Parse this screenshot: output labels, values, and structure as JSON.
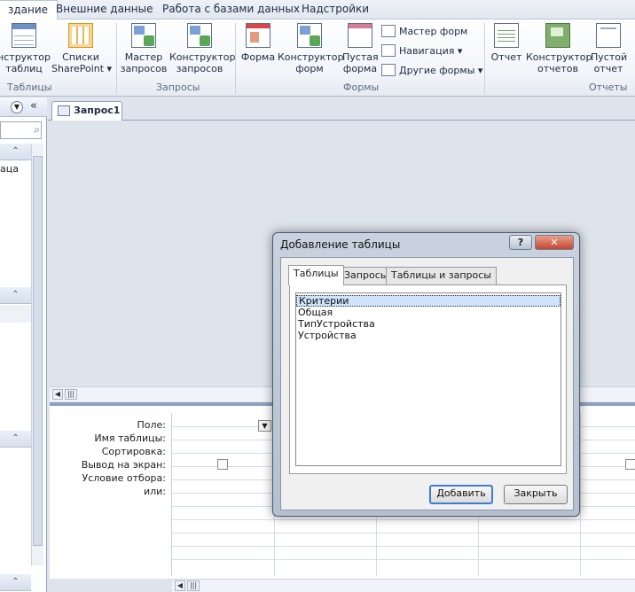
{
  "ribbon": {
    "tabs": [
      {
        "label": "здание",
        "active": true
      },
      {
        "label": "Внешние данные",
        "active": false
      },
      {
        "label": "Работа с базами данных",
        "active": false
      },
      {
        "label": "Надстройки",
        "active": false
      }
    ],
    "groups": {
      "tables": {
        "label": "Таблицы",
        "buttons": [
          {
            "line1": "нструктор",
            "line2": "таблиц",
            "icon": "table-design-icon"
          },
          {
            "line1": "Списки",
            "line2": "SharePoint ▾",
            "icon": "sharepoint-list-icon"
          }
        ]
      },
      "queries": {
        "label": "Запросы",
        "buttons": [
          {
            "line1": "Мастер",
            "line2": "запросов",
            "icon": "query-wizard-icon"
          },
          {
            "line1": "Конструктор",
            "line2": "запросов",
            "icon": "query-design-icon"
          }
        ]
      },
      "forms": {
        "label": "Формы",
        "buttons": [
          {
            "line1": "Форма",
            "line2": "",
            "icon": "form-icon"
          },
          {
            "line1": "Конструктор",
            "line2": "форм",
            "icon": "form-design-icon"
          },
          {
            "line1": "Пустая",
            "line2": "форма",
            "icon": "blank-form-icon"
          }
        ],
        "small": [
          {
            "label": "Мастер форм",
            "icon": "form-wizard-icon"
          },
          {
            "label": "Навигация ▾",
            "icon": "navigation-icon"
          },
          {
            "label": "Другие формы ▾",
            "icon": "more-forms-icon"
          }
        ]
      },
      "reports": {
        "label": "Отчеты",
        "buttons": [
          {
            "line1": "Отчет",
            "line2": "",
            "icon": "report-icon"
          },
          {
            "line1": "Конструктор",
            "line2": "отчетов",
            "icon": "report-design-icon"
          },
          {
            "line1": "Пустой",
            "line2": "отчет",
            "icon": "blank-report-icon"
          }
        ]
      }
    }
  },
  "nav": {
    "item_text": "аца"
  },
  "document": {
    "tab_title": "Запрос1"
  },
  "design_grid": {
    "row_labels": [
      "Поле:",
      "Имя таблицы:",
      "Сортировка:",
      "Вывод на экран:",
      "Условие отбора:",
      "или:"
    ]
  },
  "dialog": {
    "title": "Добавление таблицы",
    "help_label": "?",
    "close_label": "✕",
    "tabs": [
      "Таблицы",
      "Запросы",
      "Таблицы и запросы"
    ],
    "selected_tab": "Таблицы",
    "items": [
      "Критерии",
      "Общая",
      "ТипУстройства",
      "Устройства"
    ],
    "add_button": "Добавить",
    "close_button": "Закрыть"
  }
}
